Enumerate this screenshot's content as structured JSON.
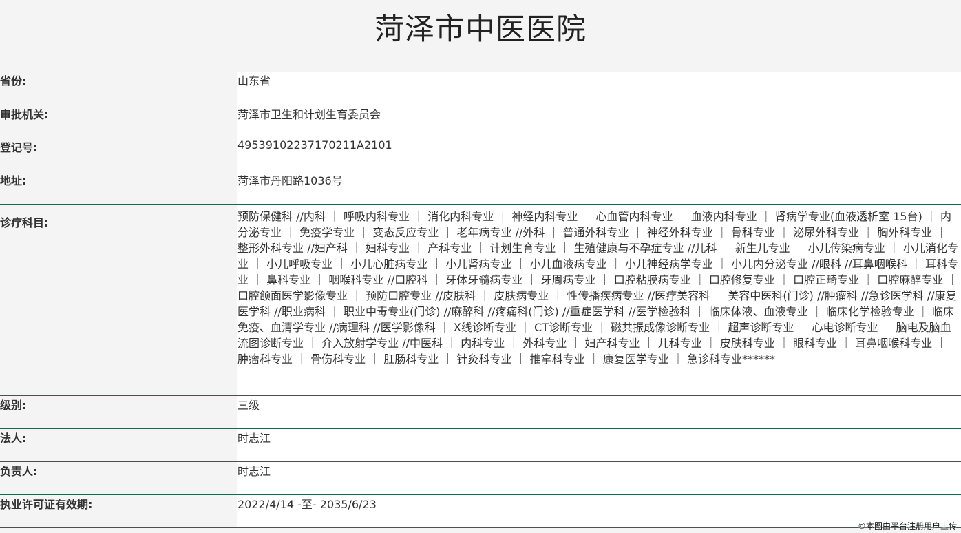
{
  "header": {
    "title": "菏泽市中医医院"
  },
  "rows": [
    {
      "label": "省份:",
      "value": "山东省"
    },
    {
      "label": "审批机关:",
      "value": "菏泽市卫生和计划生育委员会"
    },
    {
      "label": "登记号:",
      "value": "49539102237170211A2101"
    },
    {
      "label": "地址:",
      "value": "菏泽市丹阳路1036号"
    },
    {
      "label": "诊疗科目:",
      "value": "预防保健科 //内科 ｜ 呼吸内科专业 ｜ 消化内科专业 ｜ 神经内科专业 ｜ 心血管内科专业 ｜ 血液内科专业 ｜ 肾病学专业(血液透析室 15台) ｜ 内分泌专业 ｜ 免疫学专业 ｜ 变态反应专业 ｜ 老年病专业 //外科 ｜ 普通外科专业 ｜ 神经外科专业 ｜ 骨科专业 ｜ 泌尿外科专业 ｜ 胸外科专业 ｜ 整形外科专业 //妇产科 ｜ 妇科专业 ｜ 产科专业 ｜ 计划生育专业 ｜ 生殖健康与不孕症专业 //儿科 ｜ 新生儿专业 ｜ 小儿传染病专业 ｜ 小儿消化专业 ｜ 小儿呼吸专业 ｜ 小儿心脏病专业 ｜ 小儿肾病专业 ｜ 小儿血液病专业 ｜ 小儿神经病学专业 ｜ 小儿内分泌专业 //眼科 //耳鼻咽喉科 ｜ 耳科专业 ｜ 鼻科专业 ｜ 咽喉科专业 //口腔科 ｜ 牙体牙髓病专业 ｜ 牙周病专业 ｜ 口腔粘膜病专业 ｜ 口腔修复专业 ｜ 口腔正畸专业 ｜ 口腔麻醉专业 ｜ 口腔颌面医学影像专业 ｜ 预防口腔专业 //皮肤科 ｜ 皮肤病专业 ｜ 性传播疾病专业 //医疗美容科 ｜ 美容中医科(门诊) //肿瘤科 //急诊医学科 //康复医学科 //职业病科 ｜ 职业中毒专业(门诊) //麻醉科 //疼痛科(门诊) //重症医学科 //医学检验科 ｜ 临床体液、血液专业 ｜ 临床化学检验专业 ｜ 临床免疫、血清学专业 //病理科 //医学影像科 ｜ X线诊断专业 ｜ CT诊断专业 ｜ 磁共振成像诊断专业 ｜ 超声诊断专业 ｜ 心电诊断专业 ｜ 脑电及脑血流图诊断专业 ｜ 介入放射学专业 //中医科 ｜ 内科专业 ｜ 外科专业 ｜ 妇产科专业 ｜ 儿科专业 ｜ 皮肤科专业 ｜ 眼科专业 ｜ 耳鼻咽喉科专业 ｜ 肿瘤科专业 ｜ 骨伤科专业 ｜ 肛肠科专业 ｜ 针灸科专业 ｜ 推拿科专业 ｜ 康复医学专业 ｜ 急诊科专业******"
    },
    {
      "label": "级别:",
      "value": "三级"
    },
    {
      "label": "法人:",
      "value": "时志江"
    },
    {
      "label": "负责人:",
      "value": "时志江"
    },
    {
      "label": "执业许可证有效期:",
      "value": "2022/4/14 -至- 2035/6/23"
    }
  ],
  "footer": {
    "watermark": "©本图由平台注册用户上传"
  }
}
